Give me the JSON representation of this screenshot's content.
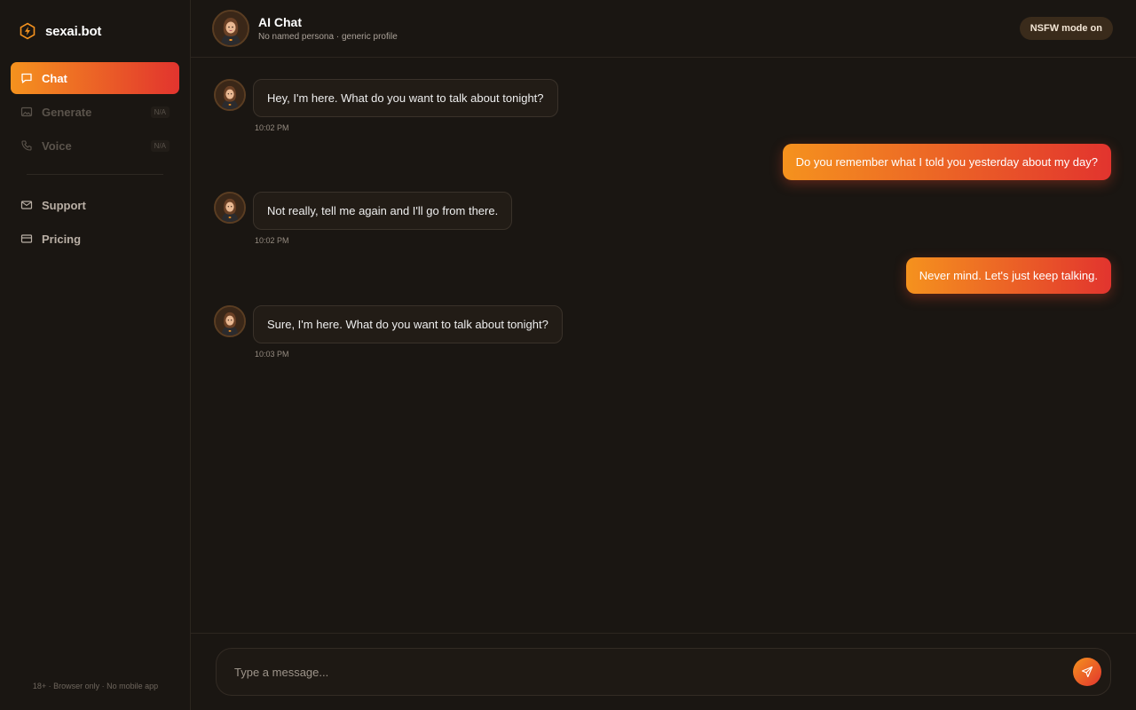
{
  "brand": {
    "name": "sexai.bot",
    "icon": "hexagon-bolt-icon",
    "accent": "#f5921e"
  },
  "sidebar": {
    "items": [
      {
        "label": "Chat",
        "icon": "chat-bubble-icon",
        "active": true
      },
      {
        "label": "Generate",
        "icon": "image-icon",
        "badge": "N/A",
        "disabled": true
      },
      {
        "label": "Voice",
        "icon": "phone-icon",
        "badge": "N/A",
        "disabled": true
      },
      {
        "label": "Support",
        "icon": "mail-icon"
      },
      {
        "label": "Pricing",
        "icon": "credit-card-icon"
      }
    ],
    "footer": "18+ · Browser only · No mobile app"
  },
  "header": {
    "title": "AI Chat",
    "subtitle": "No named persona · generic profile",
    "mode_badge": "NSFW mode on"
  },
  "messages": [
    {
      "from": "bot",
      "text": "Hey, I'm here. What do you want to talk about tonight?",
      "time": "10:02 PM"
    },
    {
      "from": "user",
      "text": "Do you remember what I told you yesterday about my day?"
    },
    {
      "from": "bot",
      "text": "Not really, tell me again and I'll go from there.",
      "time": "10:02 PM"
    },
    {
      "from": "user",
      "text": "Never mind. Let's just keep talking."
    },
    {
      "from": "bot",
      "text": "Sure, I'm here. What do you want to talk about tonight?",
      "time": "10:03 PM"
    }
  ],
  "composer": {
    "placeholder": "Type a message...",
    "value": ""
  },
  "colors": {
    "gradient_start": "#f5921e",
    "gradient_end": "#e2342e",
    "background": "#1a1612"
  }
}
